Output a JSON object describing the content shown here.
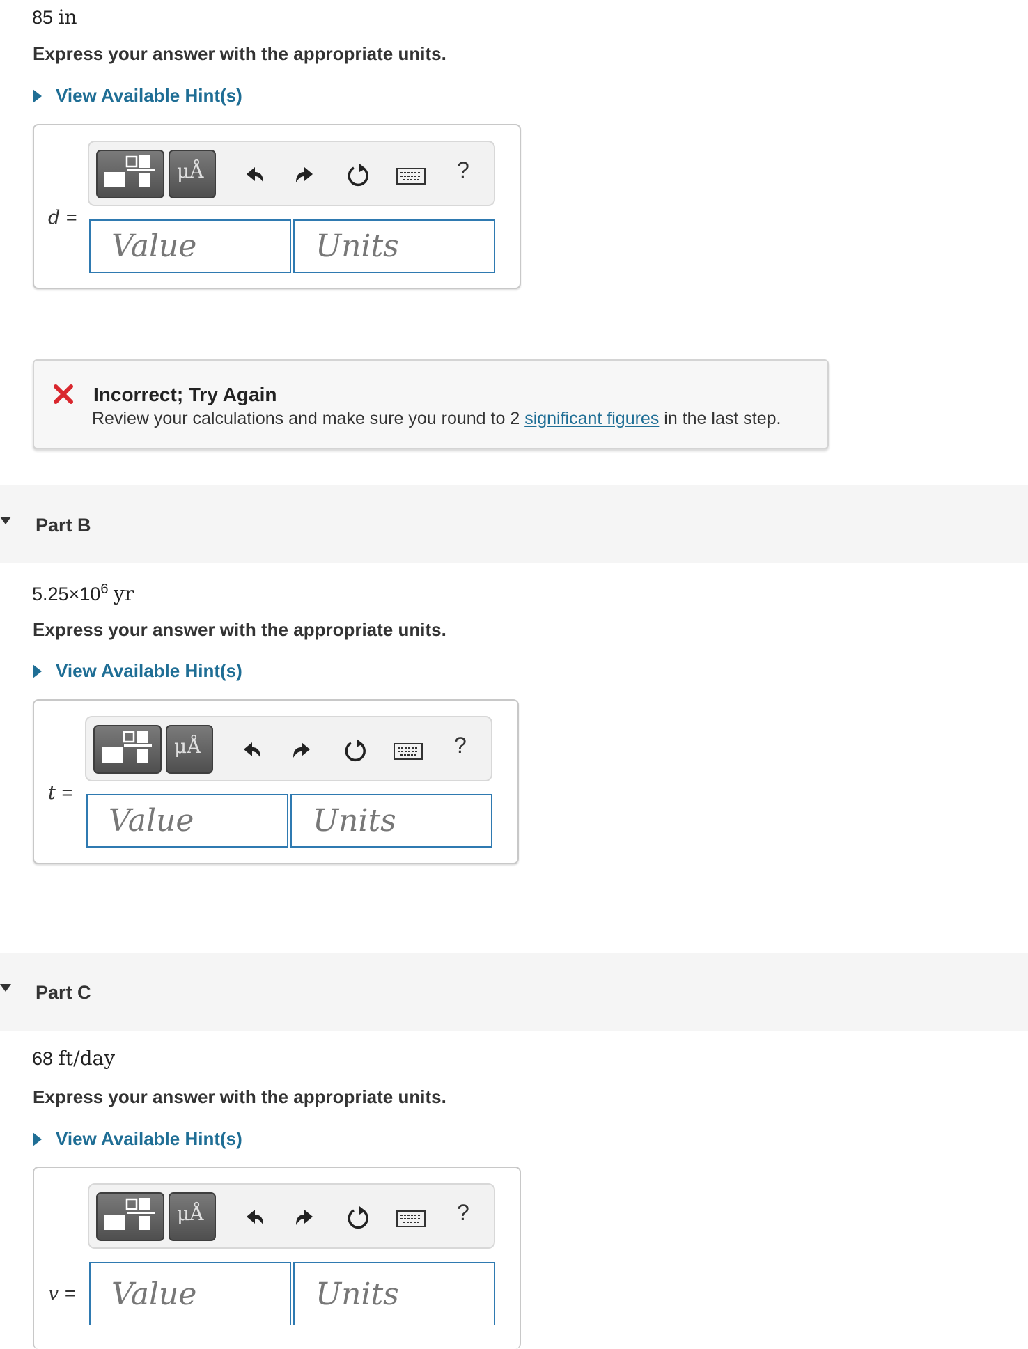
{
  "partA": {
    "given_value": "85",
    "given_unit": "in",
    "express": "Express your answer with the appropriate units.",
    "hint": "View Available Hint(s)",
    "variable": "d",
    "value_placeholder": "Value",
    "units_placeholder": "Units",
    "feedback": {
      "title": "Incorrect; Try Again",
      "message_before": "Review your calculations and make sure you round to 2",
      "link": "significant figures",
      "message_after": "in the last step."
    }
  },
  "partB": {
    "title": "Part B",
    "given_mantissa": "5.25×10",
    "given_exponent": "6",
    "given_unit": "yr",
    "express": "Express your answer with the appropriate units.",
    "hint": "View Available Hint(s)",
    "variable": "t",
    "value_placeholder": "Value",
    "units_placeholder": "Units"
  },
  "partC": {
    "title": "Part C",
    "given_value": "68",
    "given_unit": "ft/day",
    "express": "Express your answer with the appropriate units.",
    "hint": "View Available Hint(s)",
    "variable": "v",
    "value_placeholder": "Value",
    "units_placeholder": "Units"
  },
  "toolbar": {
    "units_symbol": "μÅ",
    "help": "?",
    "equals": "="
  },
  "icons": [
    "templates-icon",
    "units-icon",
    "undo-icon",
    "redo-icon",
    "reset-icon",
    "keyboard-icon",
    "help-icon",
    "error-x-icon",
    "expand-caret-icon"
  ],
  "colors": {
    "accent": "#1f6e95",
    "field_border": "#2f7ab1",
    "error": "#d9272e"
  }
}
